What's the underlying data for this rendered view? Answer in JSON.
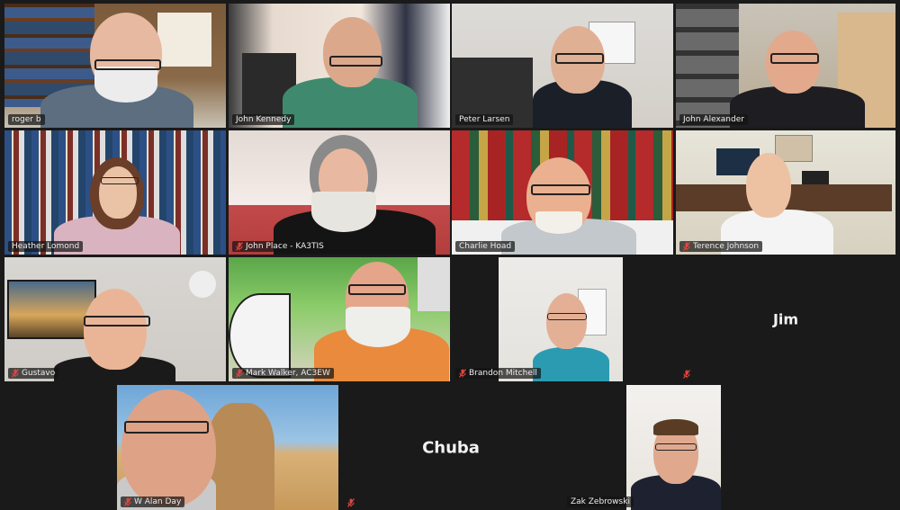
{
  "participants": [
    {
      "name": "roger b",
      "muted": false,
      "video": true
    },
    {
      "name": "John Kennedy",
      "muted": false,
      "video": true,
      "speaking": true
    },
    {
      "name": "Peter Larsen",
      "muted": false,
      "video": true
    },
    {
      "name": "John Alexander",
      "muted": false,
      "video": true
    },
    {
      "name": "Heather Lomond",
      "muted": false,
      "video": true
    },
    {
      "name": "John Place - KA3TIS",
      "muted": true,
      "video": true
    },
    {
      "name": "Charlie Hoad",
      "muted": false,
      "video": true
    },
    {
      "name": "Terence Johnson",
      "muted": true,
      "video": true
    },
    {
      "name": "Gustavo",
      "muted": true,
      "video": true
    },
    {
      "name": "Mark Walker, AC3EW",
      "muted": true,
      "video": true
    },
    {
      "name": "Brandon Mitchell",
      "muted": true,
      "video": true
    },
    {
      "name": "Jim",
      "muted": true,
      "video": false
    },
    {
      "name": "W Alan Day",
      "muted": true,
      "video": true
    },
    {
      "name": "Chuba",
      "muted": true,
      "video": false
    },
    {
      "name": "Zak Zebrowski",
      "muted": false,
      "video": true
    }
  ],
  "colors": {
    "speaking_outline": "#4ccb4c",
    "muted_icon": "#e0463e",
    "background": "#1a1a1a"
  }
}
